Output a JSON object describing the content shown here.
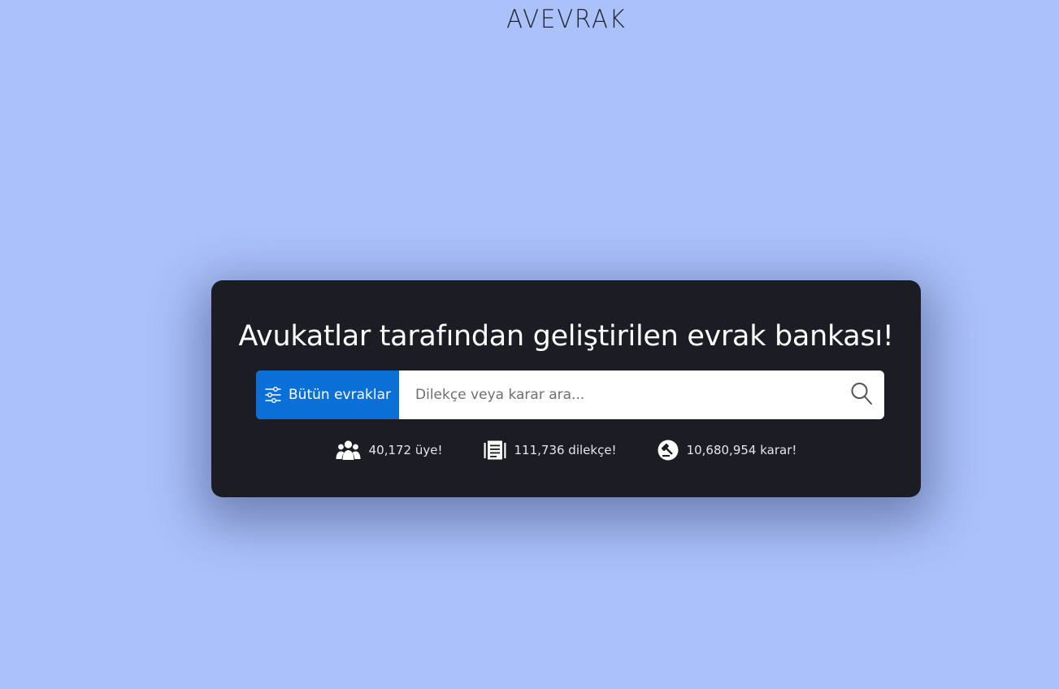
{
  "brand": {
    "logo": "AVEVRAK"
  },
  "hero": {
    "headline": "Avukatlar tarafından geliştirilen evrak bankası!",
    "filter_button": "Bütün evraklar",
    "search_placeholder": "Dilekçe veya karar ara..."
  },
  "stats": {
    "members": "40,172 üye!",
    "petitions": "111,736 dilekçe!",
    "decisions": "10,680,954 karar!"
  },
  "icons": {
    "filter": "sliders-icon",
    "search": "magnifier-icon",
    "members": "users-icon",
    "petitions": "document-icon",
    "decisions": "gavel-icon"
  },
  "colors": {
    "page_background": "#abc1fa",
    "card_background": "#1b1c24",
    "accent": "#0b6fd8"
  }
}
